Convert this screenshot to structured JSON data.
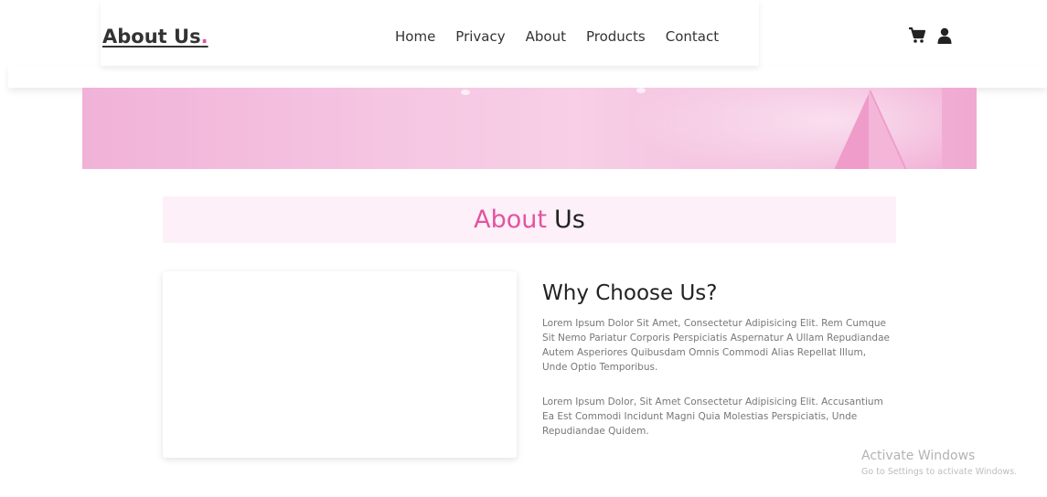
{
  "header": {
    "logo_text": "About Us",
    "logo_dot": ".",
    "nav": [
      {
        "label": "Home"
      },
      {
        "label": "Privacy"
      },
      {
        "label": "About"
      },
      {
        "label": "Products"
      },
      {
        "label": "Contact"
      }
    ],
    "icons": [
      "cart-icon",
      "user-icon"
    ]
  },
  "section": {
    "title_accent": "About",
    "title_rest": "Us"
  },
  "content": {
    "heading": "Why Choose Us?",
    "paragraphs": [
      "Lorem Ipsum Dolor Sit Amet, Consectetur Adipisicing Elit. Rem Cumque Sit Nemo Pariatur Corporis Perspiciatis Aspernatur A Ullam Repudiandae Autem Asperiores Quibusdam Omnis Commodi Alias Repellat Illum, Unde Optio Temporibus.",
      "Lorem Ipsum Dolor, Sit Amet Consectetur Adipisicing Elit. Accusantium Ea Est Commodi Incidunt Magni Quia Molestias Perspiciatis, Unde Repudiandae Quidem."
    ]
  },
  "watermark": {
    "title": "Activate Windows",
    "subtitle": "Go to Settings to activate Windows."
  },
  "colors": {
    "accent": "#e3539f",
    "text": "#333333",
    "muted": "#777777",
    "title_band": "#fdf0f8"
  }
}
